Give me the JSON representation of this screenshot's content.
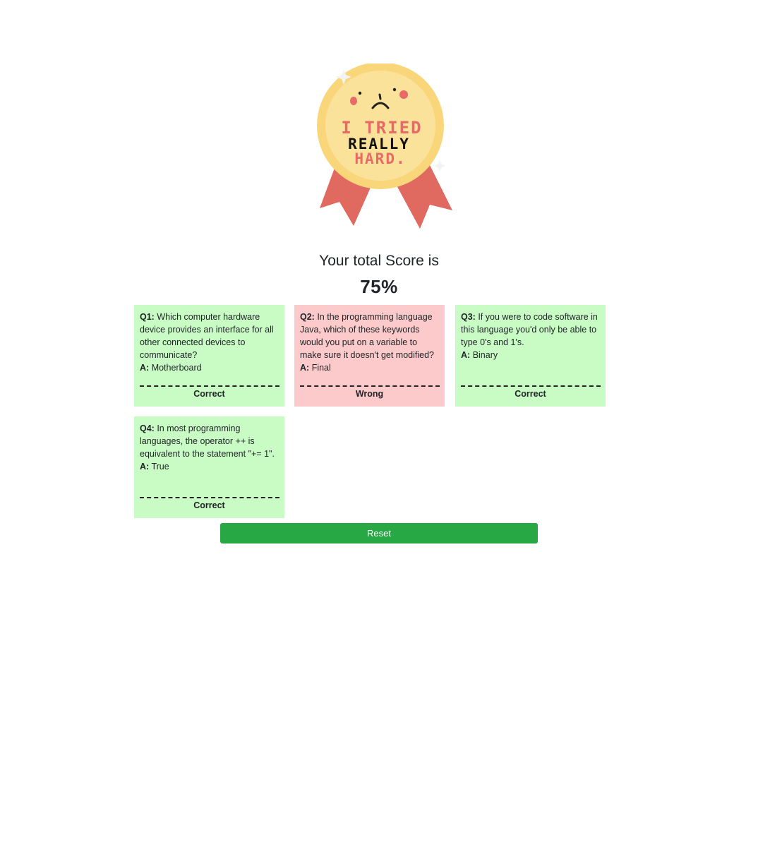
{
  "medal": {
    "line1": "I TRIED",
    "line2": "REALLY",
    "line3": "HARD."
  },
  "score": {
    "title": "Your total Score is",
    "value": "75%"
  },
  "cards": [
    {
      "q_label": "Q1:",
      "question": "Which computer hardware device provides an interface for all other connected devices to communicate?",
      "a_label": "A:",
      "answer": "Motherboard",
      "verdict": "Correct"
    },
    {
      "q_label": "Q2:",
      "question": "In the programming language Java, which of these keywords would you put on a variable to make sure it doesn't get modified?",
      "a_label": "A:",
      "answer": "Final",
      "verdict": "Wrong"
    },
    {
      "q_label": "Q3:",
      "question": "If you were to code software in this language you'd only be able to type 0's and 1's.",
      "a_label": "A:",
      "answer": "Binary",
      "verdict": "Correct"
    },
    {
      "q_label": "Q4:",
      "question": "In most programming languages, the operator ++ is equivalent to the statement \"+= 1\".",
      "a_label": "A:",
      "answer": "True",
      "verdict": "Correct"
    }
  ],
  "reset": {
    "label": "Reset"
  },
  "colors": {
    "correct_bg": "#c9fcc5",
    "wrong_bg": "#fccaca",
    "button_green": "#28a745"
  }
}
